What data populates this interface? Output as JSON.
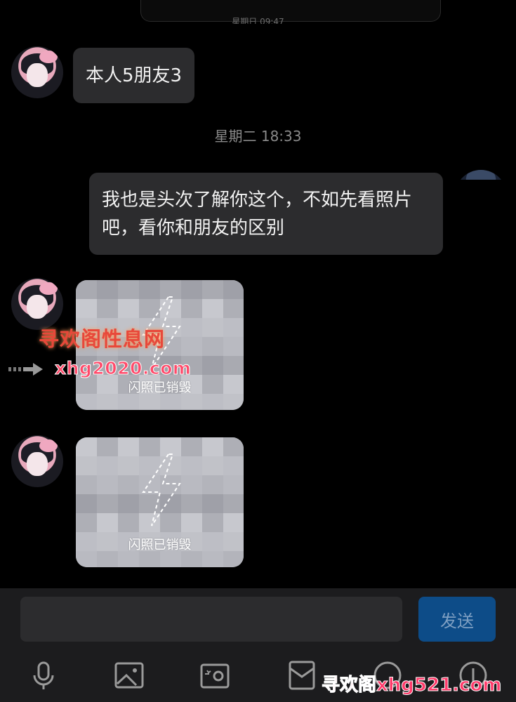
{
  "chat": {
    "previous_time": "星期日 09:47",
    "messages": [
      {
        "from": "other",
        "text": "本人5朋友3"
      },
      {
        "from": "me",
        "text": "我也是头次了解你这个，不如先看照片吧，看你和朋友的区别"
      },
      {
        "from": "other",
        "flash_label": "闪照已销毁"
      },
      {
        "from": "other",
        "flash_label": "闪照已销毁"
      }
    ],
    "timestamp": "星期二 18:33"
  },
  "watermarks": {
    "site_name": "寻欢阁性息网",
    "site_url": "xhg2020.com",
    "bottom": "寻欢阁xhg521.com"
  },
  "composer": {
    "input_value": "",
    "send_label": "发送"
  },
  "toolbar": {
    "icons": [
      "microphone-icon",
      "image-icon",
      "camera-icon",
      "red-packet-icon",
      "emoji-icon",
      "plus-icon"
    ]
  },
  "colors": {
    "background": "#000000",
    "bubble": "#2c2c2e",
    "send_button": "#0d4c88",
    "composer": "#1c1c1e"
  }
}
